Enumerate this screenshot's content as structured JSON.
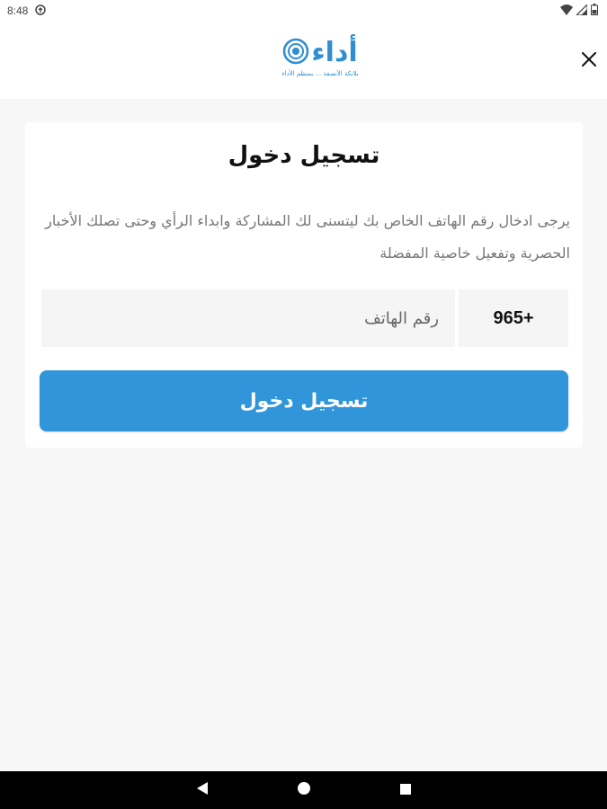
{
  "status_bar": {
    "time": "8:48",
    "icons": [
      "sync-icon",
      "wifi-icon",
      "signal-icon",
      "battery-icon"
    ]
  },
  "header": {
    "logo_text": "أداء",
    "logo_tagline": "بلانكة الأنصفة ... بمنظم الأداء",
    "close_icon": "close-icon"
  },
  "login": {
    "title": "تسجيل دخول",
    "description": "يرجى ادخال رقم الهاتف الخاص بك ليتسنى لك المشاركة وابداء الرأي وحتى تصلك الأخبار الحصرية وتفعيل خاصية المفضلة",
    "phone_placeholder": "رقم الهاتف",
    "phone_value": "",
    "country_code": "965+",
    "submit_label": "تسجيل دخول"
  },
  "nav": {
    "icons": [
      "back-icon",
      "home-icon",
      "recents-icon"
    ]
  },
  "colors": {
    "accent": "#3096d9",
    "background": "#f7f7f7",
    "card": "#ffffff",
    "nav_bar": "#000000"
  }
}
